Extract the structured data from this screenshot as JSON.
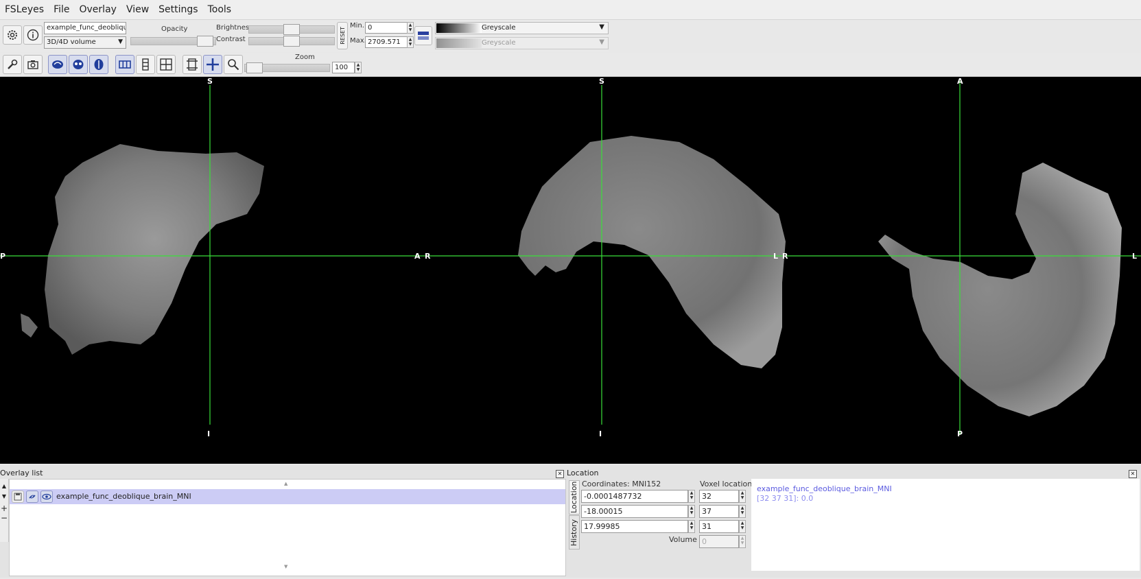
{
  "menu": [
    "FSLeyes",
    "File",
    "Overlay",
    "View",
    "Settings",
    "Tools"
  ],
  "toolbar": {
    "overlay_name": "example_func_deoblique_br",
    "overlay_type": "3D/4D volume",
    "opacity_label": "Opacity",
    "brightness_label": "Brightness",
    "contrast_label": "Contrast",
    "reset_label": "RESET",
    "min_label": "Min.",
    "max_label": "Max.",
    "min_value": "0",
    "max_value": "2709.571",
    "cmap1": "Greyscale",
    "cmap2": "Greyscale",
    "zoom_label": "Zoom",
    "zoom_value": "100"
  },
  "viewer": {
    "sagittal": {
      "top": "S",
      "bottom": "I",
      "left": "P",
      "right": "A"
    },
    "coronal": {
      "top": "S",
      "bottom": "I",
      "left": "R",
      "right": "L"
    },
    "axial": {
      "top": "A",
      "bottom": "P",
      "left": "R",
      "right": "L"
    }
  },
  "overlay_list": {
    "title": "Overlay list",
    "items": [
      "example_func_deoblique_brain_MNI"
    ]
  },
  "location": {
    "title": "Location",
    "tab_location": "Location",
    "tab_history": "History",
    "coord_label": "Coordinates: MNI152",
    "voxel_label": "Voxel location",
    "coords": [
      "-0.0001487732",
      "-18.00015",
      "17.99985"
    ],
    "voxels": [
      "32",
      "37",
      "31"
    ],
    "volume_label": "Volume",
    "volume_value": "0",
    "info_name": "example_func_deoblique_brain_MNI",
    "info_value": "[32 37 31]: 0.0"
  },
  "colors": {
    "crosshair": "#39e039",
    "accent": "#6a6ae6",
    "selection": "#ccccf5"
  }
}
